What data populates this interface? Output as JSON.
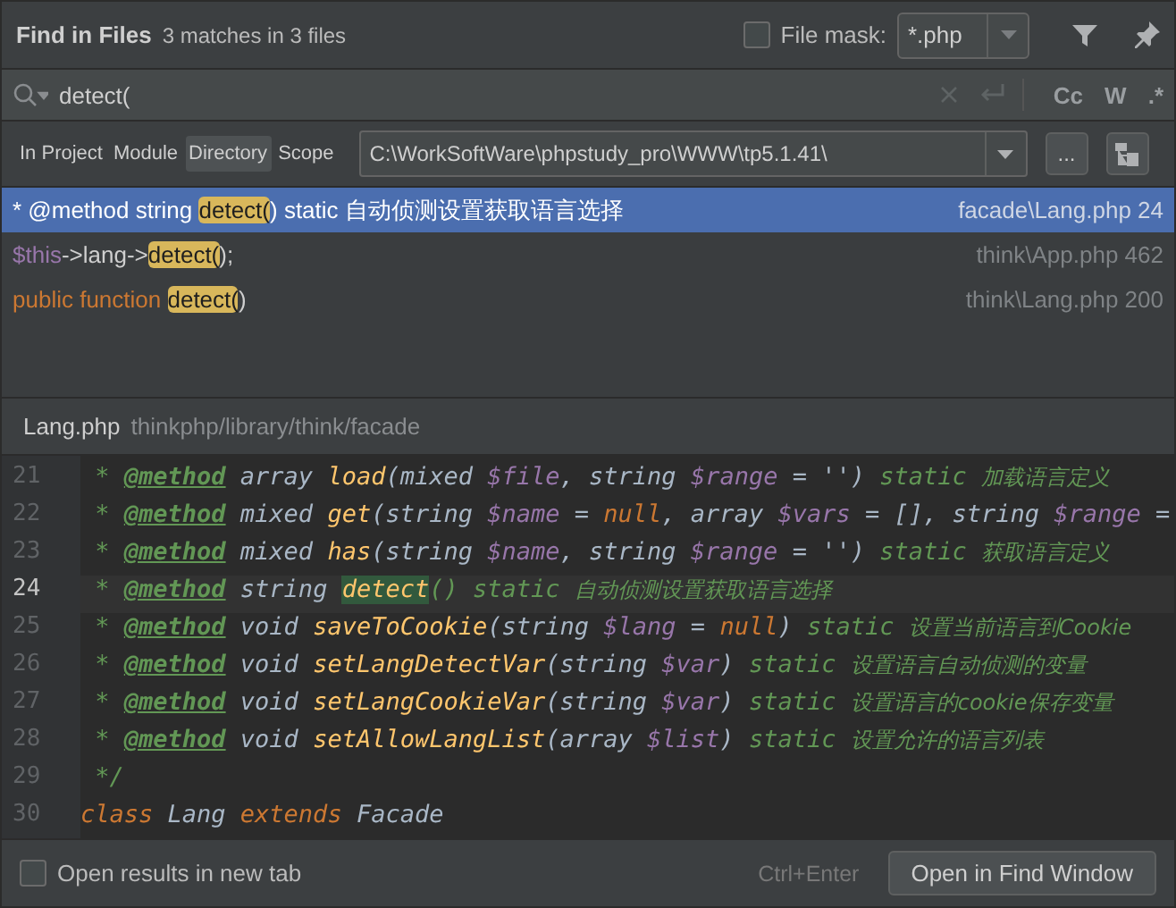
{
  "header": {
    "title": "Find in Files",
    "summary": "3 matches in 3 files",
    "file_mask": {
      "label": "File mask:",
      "checked": false,
      "value": "*.php"
    }
  },
  "search": {
    "value": "detect(",
    "options": [
      "Cc",
      "W",
      ".*"
    ]
  },
  "scopes": [
    {
      "label": "In Project",
      "selected": false
    },
    {
      "label": "Module",
      "selected": false
    },
    {
      "label": "Directory",
      "selected": true
    },
    {
      "label": "Scope",
      "selected": false
    }
  ],
  "directory": {
    "value": "C:\\WorkSoftWare\\phpstudy_pro\\WWW\\tp5.1.41\\",
    "browse": "..."
  },
  "results": [
    {
      "selected": true,
      "parts": [
        {
          "text": "* @method string ",
          "kind": "plain"
        },
        {
          "text": "detect(",
          "kind": "match"
        },
        {
          "text": ") static 自动侦测设置获取语言选择",
          "kind": "plain"
        }
      ],
      "location": "facade\\Lang.php 24"
    },
    {
      "selected": false,
      "parts": [
        {
          "text": "$this",
          "kind": "var"
        },
        {
          "text": "->lang->",
          "kind": "plain"
        },
        {
          "text": "detect(",
          "kind": "match"
        },
        {
          "text": ");",
          "kind": "plain"
        }
      ],
      "location": "think\\App.php 462"
    },
    {
      "selected": false,
      "parts": [
        {
          "text": "public function ",
          "kind": "keyword"
        },
        {
          "text": "detect(",
          "kind": "match"
        },
        {
          "text": ")",
          "kind": "plain"
        }
      ],
      "location": "think\\Lang.php 200"
    }
  ],
  "preview": {
    "file": "Lang.php",
    "path": "thinkphp/library/think/facade"
  },
  "code": [
    {
      "number": "21",
      "current": false,
      "tokens": [
        {
          "text": " * ",
          "kind": "comment"
        },
        {
          "text": "@method",
          "kind": "tag"
        },
        {
          "text": " array ",
          "kind": "type"
        },
        {
          "text": "load",
          "kind": "fn"
        },
        {
          "text": "(",
          "kind": "type"
        },
        {
          "text": "mixed ",
          "kind": "type"
        },
        {
          "text": "$file",
          "kind": "var"
        },
        {
          "text": ", string ",
          "kind": "type"
        },
        {
          "text": "$range",
          "kind": "var"
        },
        {
          "text": " = '') ",
          "kind": "type"
        },
        {
          "text": "static ",
          "kind": "comment"
        },
        {
          "text": "加载语言定义",
          "kind": "cjk"
        }
      ]
    },
    {
      "number": "22",
      "current": false,
      "tokens": [
        {
          "text": " * ",
          "kind": "comment"
        },
        {
          "text": "@method",
          "kind": "tag"
        },
        {
          "text": " mixed ",
          "kind": "type"
        },
        {
          "text": "get",
          "kind": "fn"
        },
        {
          "text": "(string ",
          "kind": "type"
        },
        {
          "text": "$name",
          "kind": "var"
        },
        {
          "text": " = ",
          "kind": "type"
        },
        {
          "text": "null",
          "kind": "keyword"
        },
        {
          "text": ", array ",
          "kind": "type"
        },
        {
          "text": "$vars",
          "kind": "var"
        },
        {
          "text": " = [], string ",
          "kind": "type"
        },
        {
          "text": "$range",
          "kind": "var"
        },
        {
          "text": " =",
          "kind": "type"
        }
      ]
    },
    {
      "number": "23",
      "current": false,
      "tokens": [
        {
          "text": " * ",
          "kind": "comment"
        },
        {
          "text": "@method",
          "kind": "tag"
        },
        {
          "text": " mixed ",
          "kind": "type"
        },
        {
          "text": "has",
          "kind": "fn"
        },
        {
          "text": "(string ",
          "kind": "type"
        },
        {
          "text": "$name",
          "kind": "var"
        },
        {
          "text": ", string ",
          "kind": "type"
        },
        {
          "text": "$range",
          "kind": "var"
        },
        {
          "text": " = '') ",
          "kind": "type"
        },
        {
          "text": "static ",
          "kind": "comment"
        },
        {
          "text": "获取语言定义",
          "kind": "cjk"
        }
      ]
    },
    {
      "number": "24",
      "current": true,
      "tokens": [
        {
          "text": " * ",
          "kind": "comment"
        },
        {
          "text": "@method",
          "kind": "tag"
        },
        {
          "text": " string ",
          "kind": "type"
        },
        {
          "text": "detect",
          "kind": "match"
        },
        {
          "text": "() static ",
          "kind": "comment"
        },
        {
          "text": "自动侦测设置获取语言选择",
          "kind": "cjk"
        }
      ]
    },
    {
      "number": "25",
      "current": false,
      "tokens": [
        {
          "text": " * ",
          "kind": "comment"
        },
        {
          "text": "@method",
          "kind": "tag"
        },
        {
          "text": " void ",
          "kind": "type"
        },
        {
          "text": "saveToCookie",
          "kind": "fn"
        },
        {
          "text": "(string ",
          "kind": "type"
        },
        {
          "text": "$lang",
          "kind": "var"
        },
        {
          "text": " = ",
          "kind": "type"
        },
        {
          "text": "null",
          "kind": "keyword"
        },
        {
          "text": ") ",
          "kind": "type"
        },
        {
          "text": "static ",
          "kind": "comment"
        },
        {
          "text": "设置当前语言到Cookie",
          "kind": "cjk"
        }
      ]
    },
    {
      "number": "26",
      "current": false,
      "tokens": [
        {
          "text": " * ",
          "kind": "comment"
        },
        {
          "text": "@method",
          "kind": "tag"
        },
        {
          "text": " void ",
          "kind": "type"
        },
        {
          "text": "setLangDetectVar",
          "kind": "fn"
        },
        {
          "text": "(string ",
          "kind": "type"
        },
        {
          "text": "$var",
          "kind": "var"
        },
        {
          "text": ") ",
          "kind": "type"
        },
        {
          "text": "static ",
          "kind": "comment"
        },
        {
          "text": "设置语言自动侦测的变量",
          "kind": "cjk"
        }
      ]
    },
    {
      "number": "27",
      "current": false,
      "tokens": [
        {
          "text": " * ",
          "kind": "comment"
        },
        {
          "text": "@method",
          "kind": "tag"
        },
        {
          "text": " void ",
          "kind": "type"
        },
        {
          "text": "setLangCookieVar",
          "kind": "fn"
        },
        {
          "text": "(string ",
          "kind": "type"
        },
        {
          "text": "$var",
          "kind": "var"
        },
        {
          "text": ") ",
          "kind": "type"
        },
        {
          "text": "static ",
          "kind": "comment"
        },
        {
          "text": "设置语言的cookie保存变量",
          "kind": "cjk"
        }
      ]
    },
    {
      "number": "28",
      "current": false,
      "tokens": [
        {
          "text": " * ",
          "kind": "comment"
        },
        {
          "text": "@method",
          "kind": "tag"
        },
        {
          "text": " void ",
          "kind": "type"
        },
        {
          "text": "setAllowLangList",
          "kind": "fn"
        },
        {
          "text": "(array ",
          "kind": "type"
        },
        {
          "text": "$list",
          "kind": "var"
        },
        {
          "text": ") ",
          "kind": "type"
        },
        {
          "text": "static ",
          "kind": "comment"
        },
        {
          "text": "设置允许的语言列表",
          "kind": "cjk"
        }
      ]
    },
    {
      "number": "29",
      "current": false,
      "tokens": [
        {
          "text": " */",
          "kind": "comment"
        }
      ]
    },
    {
      "number": "30",
      "current": false,
      "tokens": [
        {
          "text": "class ",
          "kind": "keyword"
        },
        {
          "text": "Lang ",
          "kind": "type"
        },
        {
          "text": "extends ",
          "kind": "keyword"
        },
        {
          "text": "Facade",
          "kind": "type"
        }
      ]
    }
  ],
  "footer": {
    "new_tab": {
      "label": "Open results in new tab",
      "checked": false
    },
    "shortcut": "Ctrl+Enter",
    "button": "Open in Find Window"
  }
}
